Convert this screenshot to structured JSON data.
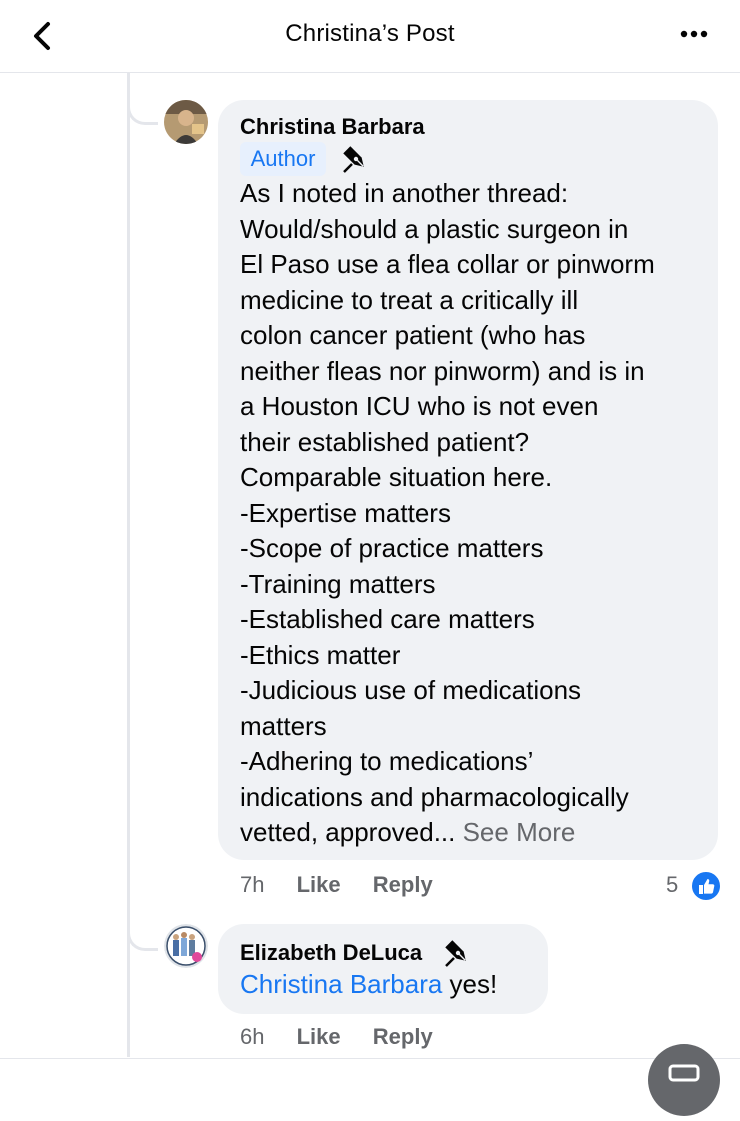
{
  "header": {
    "title": "Christina’s Post",
    "back_icon": "chevron-left-icon",
    "more_icon": "more-horizontal-icon"
  },
  "comment": {
    "author_name": "Christina Barbara",
    "badge": "Author",
    "badge_icon": "pen-icon",
    "text_lines": [
      "As I noted in another thread:",
      "Would/should a plastic surgeon in",
      "El Paso use a flea collar or pinworm",
      "medicine to treat a critically ill",
      "colon cancer patient (who has",
      "neither fleas nor pinworm) and is in",
      "a Houston ICU who is not even",
      "their established patient?",
      "Comparable situation here.",
      "-Expertise matters",
      "-Scope of practice matters",
      "-Training matters",
      "-Established care matters",
      "-Ethics matter",
      "-Judicious use of medications",
      "matters",
      "-Adhering to medications’",
      "indications and pharmacologically"
    ],
    "last_line_text": "vetted, approved... ",
    "see_more": "See More",
    "time": "7h",
    "like_label": "Like",
    "reply_label": "Reply",
    "reaction_count": "5",
    "reaction_icon": "like-reaction-icon"
  },
  "reply": {
    "author_name": "Elizabeth DeLuca",
    "badge_icon": "pen-icon",
    "mention": "Christina Barbara",
    "text": " yes!",
    "time": "6h",
    "like_label": "Like",
    "reply_label": "Reply"
  },
  "colors": {
    "accent": "#1877f2",
    "bubble": "#f0f2f5",
    "muted": "#65676b"
  }
}
